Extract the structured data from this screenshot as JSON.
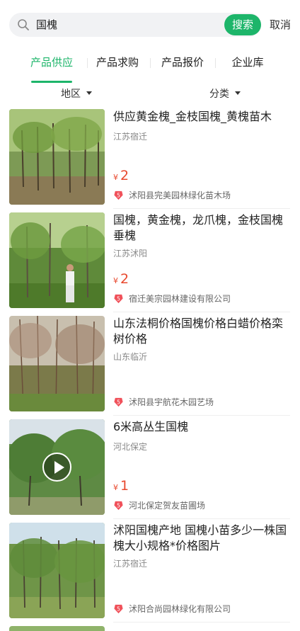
{
  "search": {
    "query": "国槐",
    "button_label": "搜索",
    "cancel_label": "取消",
    "icon": "search-icon"
  },
  "tabs": [
    {
      "label": "产品供应",
      "active": true
    },
    {
      "label": "产品求购",
      "active": false
    },
    {
      "label": "产品报价",
      "active": false
    },
    {
      "label": "企业库",
      "active": false
    }
  ],
  "filters": {
    "region": "地区",
    "category": "分类"
  },
  "colors": {
    "accent": "#1db56a",
    "price": "#e8492e",
    "badge": "#f0515a"
  },
  "items": [
    {
      "title": "供应黄金槐_金枝国槐_黄槐苗木",
      "location": "江苏宿迁",
      "price_symbol": "¥",
      "price": "2",
      "badge": "5",
      "company": "沭阳县完美园林绿化苗木场",
      "video": false
    },
    {
      "title": "国槐，黄金槐，龙爪槐，金枝国槐垂槐",
      "location": "江苏沭阳",
      "price_symbol": "¥",
      "price": "2",
      "badge": "5",
      "company": "宿迁美宗园林建设有限公司",
      "video": false
    },
    {
      "title": "山东法桐价格国槐价格白蜡价格栾树价格",
      "location": "山东临沂",
      "price_symbol": "",
      "price": "",
      "badge": "5",
      "company": "沭阳县宇航花木园艺场",
      "video": false
    },
    {
      "title": "6米高丛生国槐",
      "location": "河北保定",
      "price_symbol": "¥",
      "price": "1",
      "badge": "5",
      "company": "河北保定贺友苗圃场",
      "video": true
    },
    {
      "title": "沭阳国槐产地 国槐小苗多少一株国槐大小规格*价格图片",
      "location": "江苏宿迁",
      "price_symbol": "",
      "price": "",
      "badge": "5",
      "company": "沭阳合尚园林绿化有限公司",
      "video": false
    }
  ]
}
